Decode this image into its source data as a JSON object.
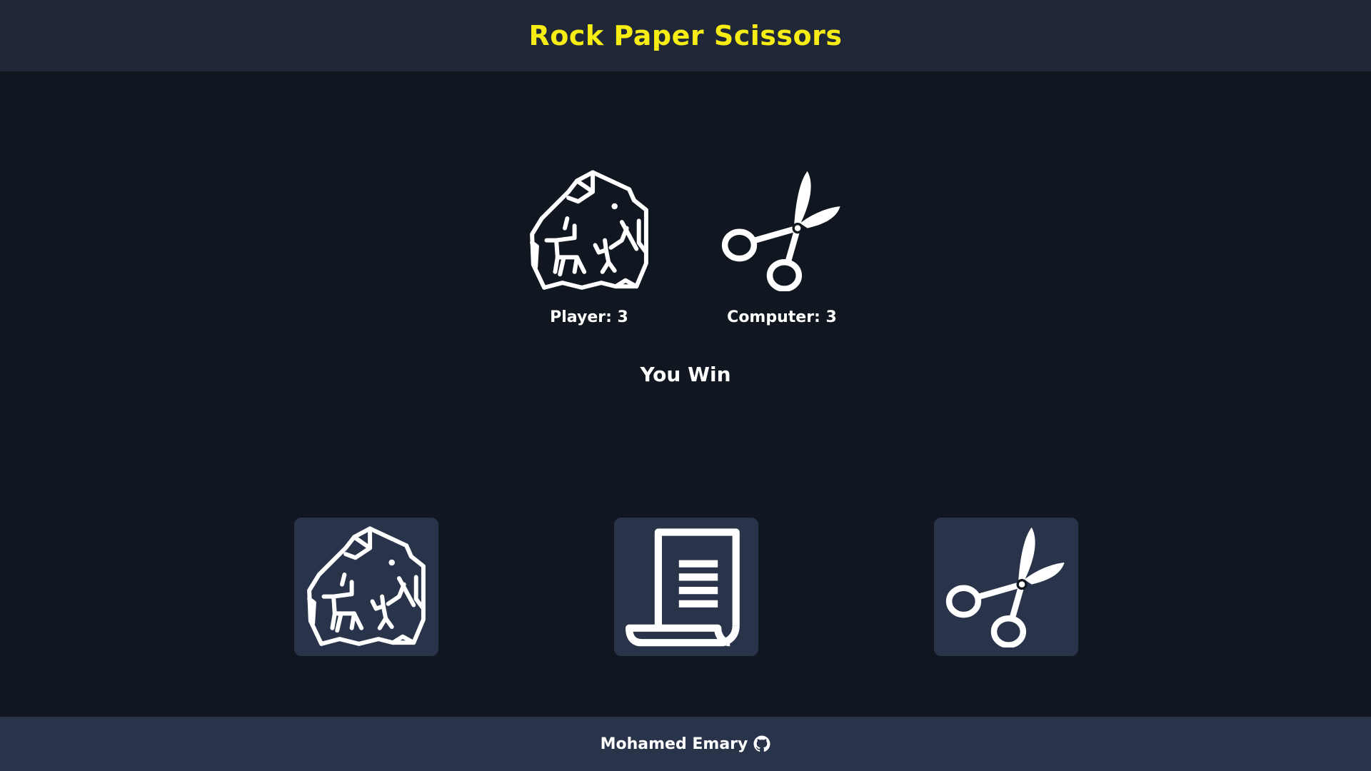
{
  "header": {
    "title": "Rock Paper Scissors"
  },
  "arena": {
    "player_choice_icon": "rock-icon",
    "computer_choice_icon": "scissors-icon",
    "player_score": "Player: 3",
    "computer_score": "Computer: 3",
    "result": "You Win"
  },
  "choices": [
    {
      "id": "rock",
      "icon": "rock-icon"
    },
    {
      "id": "paper",
      "icon": "paper-icon"
    },
    {
      "id": "scissors",
      "icon": "scissors-icon"
    }
  ],
  "footer": {
    "author": "Mohamed Emary",
    "icon": "github-icon"
  },
  "colors": {
    "title": "#f7ec14",
    "header_bg": "#202838",
    "page_bg": "#111720",
    "button_bg": "#29344a",
    "footer_bg": "#29344a"
  }
}
